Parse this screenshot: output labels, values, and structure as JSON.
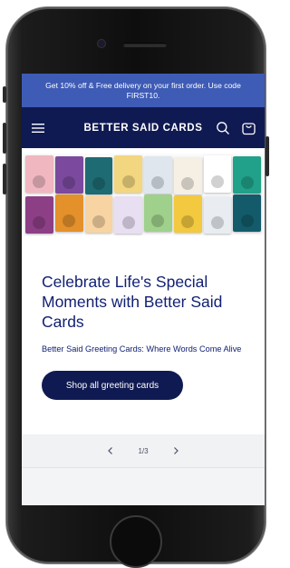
{
  "announcement": {
    "text": "Get 10% off & Free delivery on your first order. Use code FIRST10."
  },
  "header": {
    "logo_text": "BETTER SAID CARDS",
    "menu_icon": "hamburger-menu-icon",
    "search_icon": "search-icon",
    "cart_icon": "shopping-bag-icon"
  },
  "banner": {
    "cards": [
      {
        "label": "",
        "color": "#f0b7c0"
      },
      {
        "label": "",
        "color": "#7b4a9e"
      },
      {
        "label": "",
        "color": "#1e6b73"
      },
      {
        "label": "",
        "color": "#f2d680"
      },
      {
        "label": "",
        "color": "#dfe6ee"
      },
      {
        "label": "",
        "color": "#f5efe4"
      },
      {
        "label": "",
        "color": "#ffffff"
      },
      {
        "label": "",
        "color": "#21a189"
      },
      {
        "label": "",
        "color": "#8d3f86"
      },
      {
        "label": "",
        "color": "#e4902b"
      },
      {
        "label": "",
        "color": "#f7d4a2"
      },
      {
        "label": "",
        "color": "#e8dff2"
      },
      {
        "label": "",
        "color": "#9fd18c"
      },
      {
        "label": "",
        "color": "#f2c93f"
      },
      {
        "label": "",
        "color": "#e9edf2"
      },
      {
        "label": "",
        "color": "#135b6b"
      }
    ]
  },
  "hero": {
    "heading": "Celebrate Life's Special Moments with Better Said Cards",
    "subheading": "Better Said Greeting Cards: Where Words Come Alive",
    "cta_label": "Shop all greeting cards"
  },
  "slider": {
    "counter": "1/3",
    "prev_icon": "chevron-left-icon",
    "next_icon": "chevron-right-icon"
  },
  "colors": {
    "announcement_bg": "#3e5bb5",
    "header_bg": "#101a52",
    "heading_text": "#122173",
    "cta_bg": "#101a52"
  }
}
